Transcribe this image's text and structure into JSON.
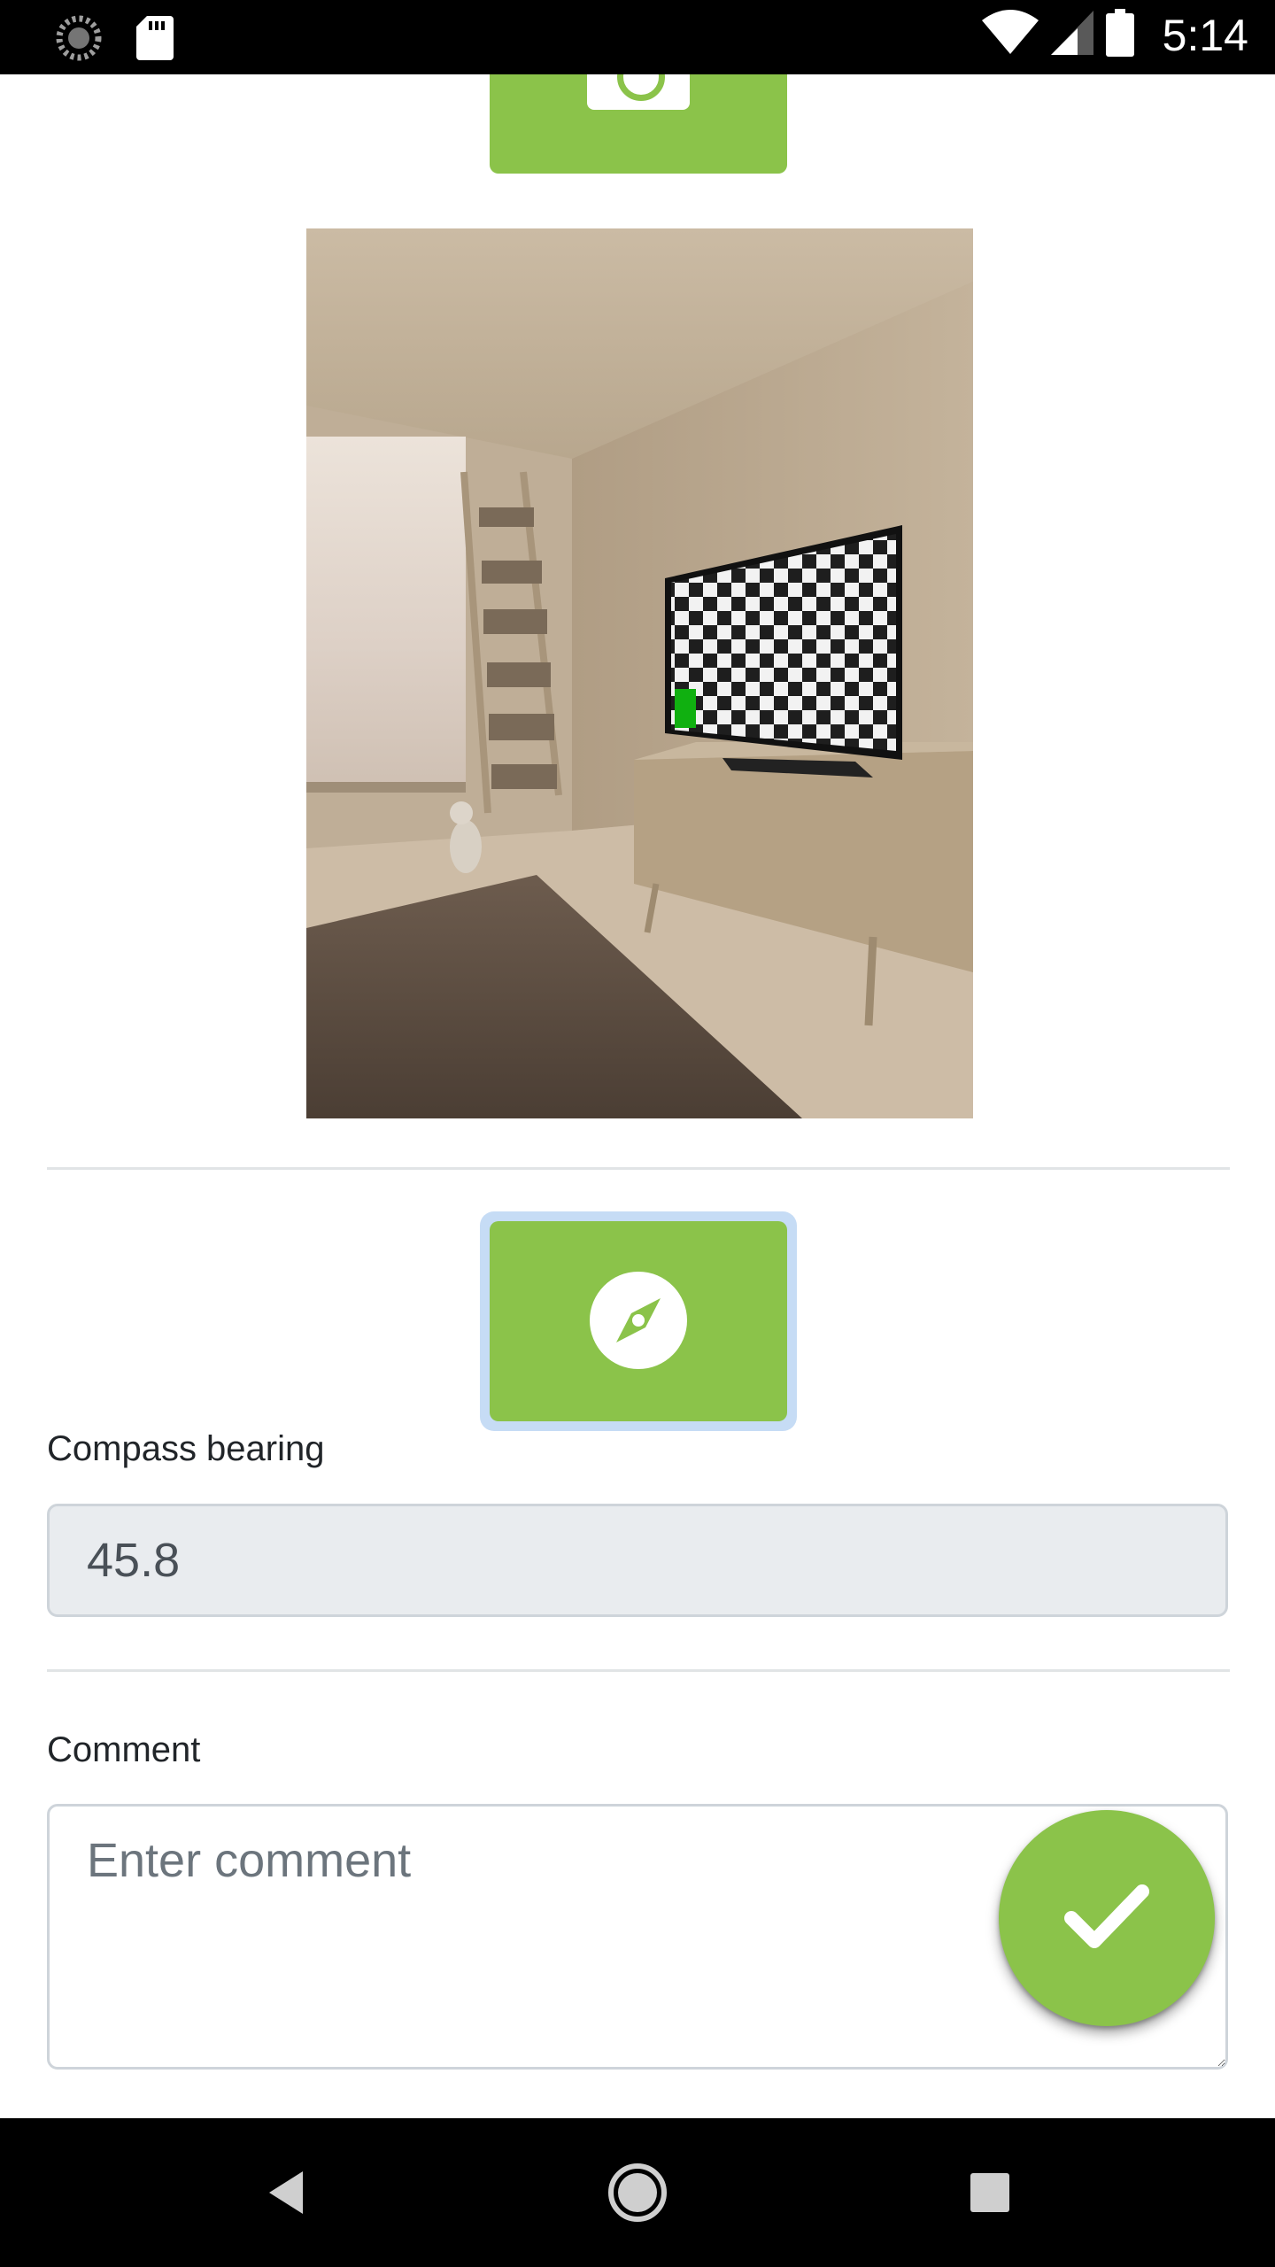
{
  "status_bar": {
    "time": "5:14",
    "icons": [
      "loading-icon",
      "sd-card-icon",
      "wifi-icon",
      "signal-icon",
      "battery-icon"
    ]
  },
  "photo_section": {
    "capture_button_icon": "camera-icon",
    "photo_subject": "wooden room with TV showing checkerboard, ladder bookshelf and cat"
  },
  "compass_section": {
    "button_icon": "compass-icon",
    "label": "Compass bearing",
    "value": "45.8"
  },
  "comment_section": {
    "label": "Comment",
    "placeholder": "Enter comment",
    "value": ""
  },
  "fab": {
    "icon": "checkmark-icon"
  },
  "nav_bar": {
    "icons": [
      "back-icon",
      "home-icon",
      "recents-icon"
    ]
  },
  "colors": {
    "accent": "#8bc34a",
    "focus_ring": "#c6dcf5",
    "disabled_field_bg": "#e9ecef",
    "field_border": "#ced4da",
    "divider": "#e1e4e6"
  }
}
